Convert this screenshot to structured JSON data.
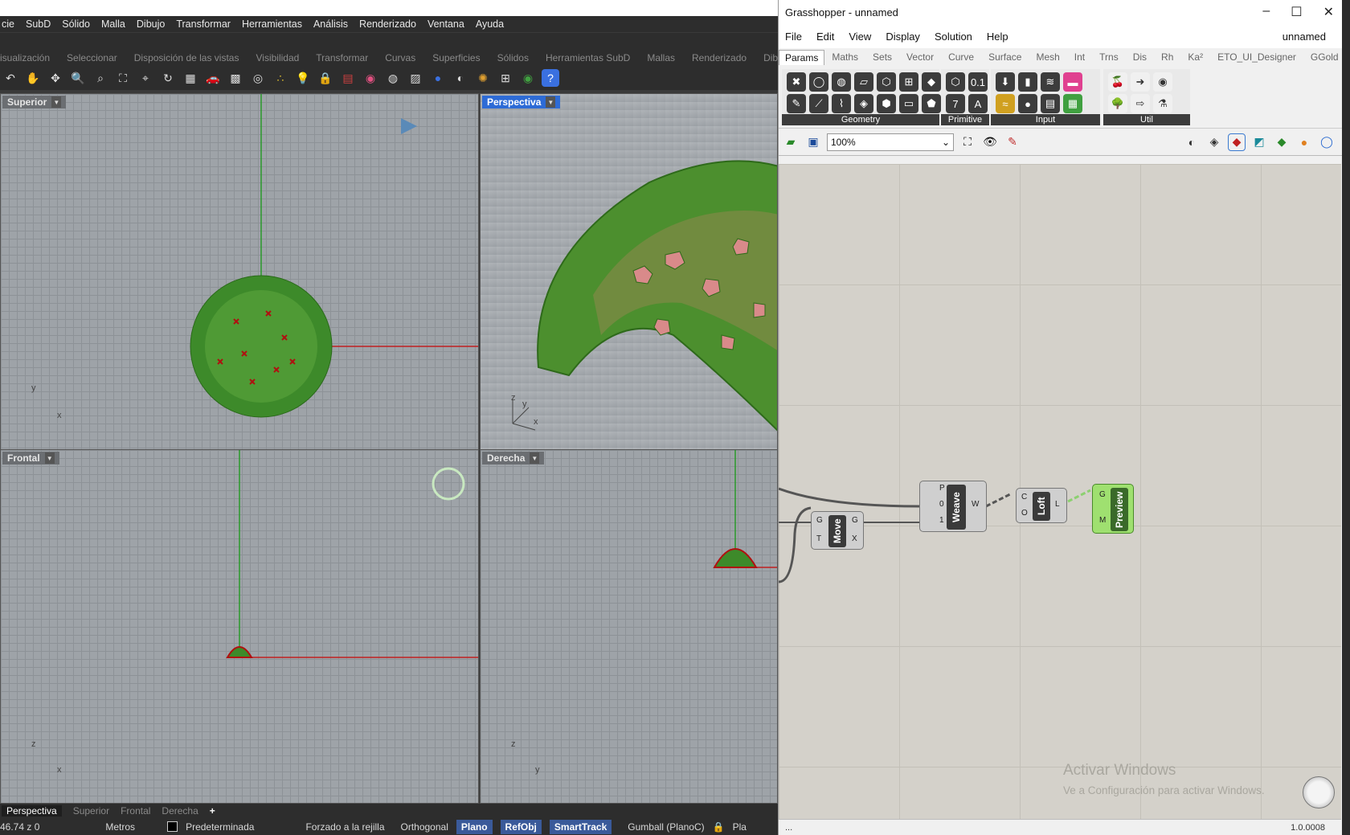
{
  "rhino": {
    "menu": [
      "cie",
      "SubD",
      "Sólido",
      "Malla",
      "Dibujo",
      "Transformar",
      "Herramientas",
      "Análisis",
      "Renderizado",
      "Ventana",
      "Ayuda"
    ],
    "tabs": [
      "isualización",
      "Seleccionar",
      "Disposición de las vistas",
      "Visibilidad",
      "Transformar",
      "Curvas",
      "Superficies",
      "Sólidos",
      "Herramientas SubD",
      "Mallas",
      "Renderizado",
      "Dibujo"
    ],
    "tool_icons": [
      "undo-icon",
      "pan-icon",
      "rotate-view-icon",
      "zoom-icon",
      "zoom-window-icon",
      "zoom-extents-icon",
      "zoom-selected-icon",
      "rotate-icon",
      "four-views-icon",
      "car-icon",
      "grid-icon",
      "target-icon",
      "points-icon",
      "light-icon",
      "lock-icon",
      "layer-icon",
      "color-wheel-icon",
      "sphere-wire-icon",
      "mesh-icon",
      "render-sphere-icon",
      "render-icon",
      "settings-icon",
      "gumball-icon",
      "globe-icon",
      "help-icon"
    ],
    "viewports": {
      "top": {
        "label": "Superior",
        "axes": [
          "y",
          "x"
        ]
      },
      "perspective": {
        "label": "Perspectiva",
        "axes": [
          "z",
          "y",
          "x"
        ]
      },
      "front": {
        "label": "Frontal",
        "axes": [
          "z",
          "x"
        ]
      },
      "right": {
        "label": "Derecha",
        "axes": [
          "z",
          "y"
        ]
      }
    },
    "view_tabs": [
      "Perspectiva",
      "Superior",
      "Frontal",
      "Derecha"
    ],
    "status": {
      "coords": "46.74   z 0",
      "units": "Metros",
      "layer": "Predeterminada",
      "snap_grid": "Forzado a la rejilla",
      "ortho": "Orthogonal",
      "plano": "Plano",
      "refobj": "RefObj",
      "smarttrack": "SmartTrack",
      "gumball": "Gumball (PlanoC)",
      "extra": "Pla"
    }
  },
  "grasshopper": {
    "title": "Grasshopper - unnamed",
    "doc_name": "unnamed",
    "menu": [
      "File",
      "Edit",
      "View",
      "Display",
      "Solution",
      "Help"
    ],
    "tabs": [
      "Params",
      "Maths",
      "Sets",
      "Vector",
      "Curve",
      "Surface",
      "Mesh",
      "Int",
      "Trns",
      "Dis",
      "Rh",
      "Ka²",
      "ETO_UI_Designer",
      "GGold"
    ],
    "panels": [
      "Geometry",
      "Primitive",
      "Input",
      "Util"
    ],
    "zoom": "100%",
    "components": {
      "weave": {
        "name": "Weave",
        "inputs": [
          "P",
          "0",
          "1"
        ],
        "outputs": [
          "W"
        ]
      },
      "move": {
        "name": "Move",
        "inputs": [
          "G",
          "T"
        ],
        "outputs": [
          "G",
          "X"
        ]
      },
      "loft": {
        "name": "Loft",
        "inputs": [
          "C",
          "O"
        ],
        "outputs": [
          "L"
        ]
      },
      "preview": {
        "name": "Preview",
        "inputs": [
          "G",
          "M"
        ]
      }
    },
    "watermark_title": "Activar Windows",
    "watermark_sub": "Ve a Configuración para activar Windows.",
    "status_left": "...",
    "version": "1.0.0008"
  }
}
